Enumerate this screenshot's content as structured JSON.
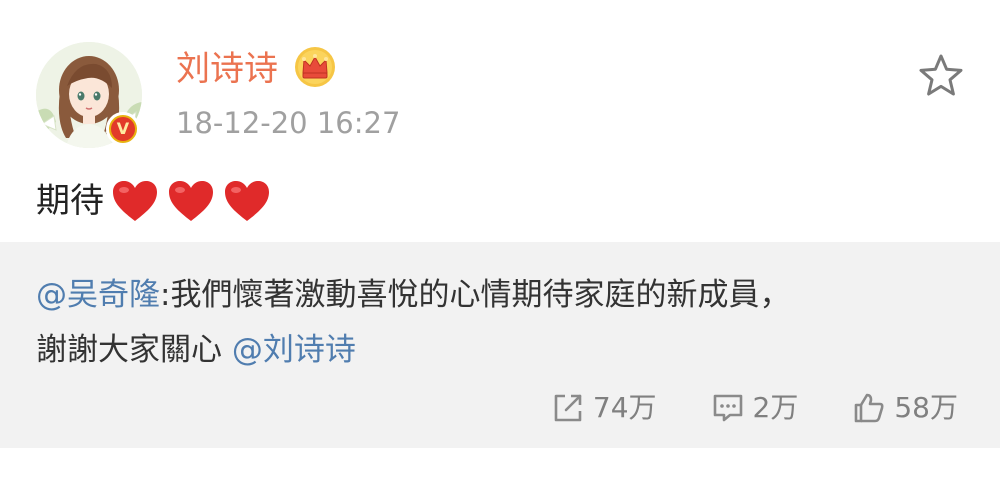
{
  "post": {
    "user": {
      "name": "刘诗诗",
      "timestamp": "18-12-20 16:27",
      "avatar_icon": "cartoon-girl-avatar",
      "badge_icon": "crown-icon",
      "verified_icon": "verified-v-icon",
      "verified_label": "V"
    },
    "favorite_icon": "star-icon",
    "text": "期待",
    "hearts": [
      "heart-icon",
      "heart-icon",
      "heart-icon"
    ],
    "repost": {
      "mention": "@吴奇隆",
      "body": ":我們懷著激動喜悅的心情期待家庭的新成員，",
      "body_line2": "謝謝大家關心 ",
      "mention2": "@刘诗诗"
    },
    "actions": {
      "repost_count": "74万",
      "comment_count": "2万",
      "like_count": "58万"
    }
  },
  "colors": {
    "username": "#eb7350",
    "mention": "#507daf",
    "repost_bg": "#f2f2f2",
    "meta_text": "#a0a0a0"
  }
}
